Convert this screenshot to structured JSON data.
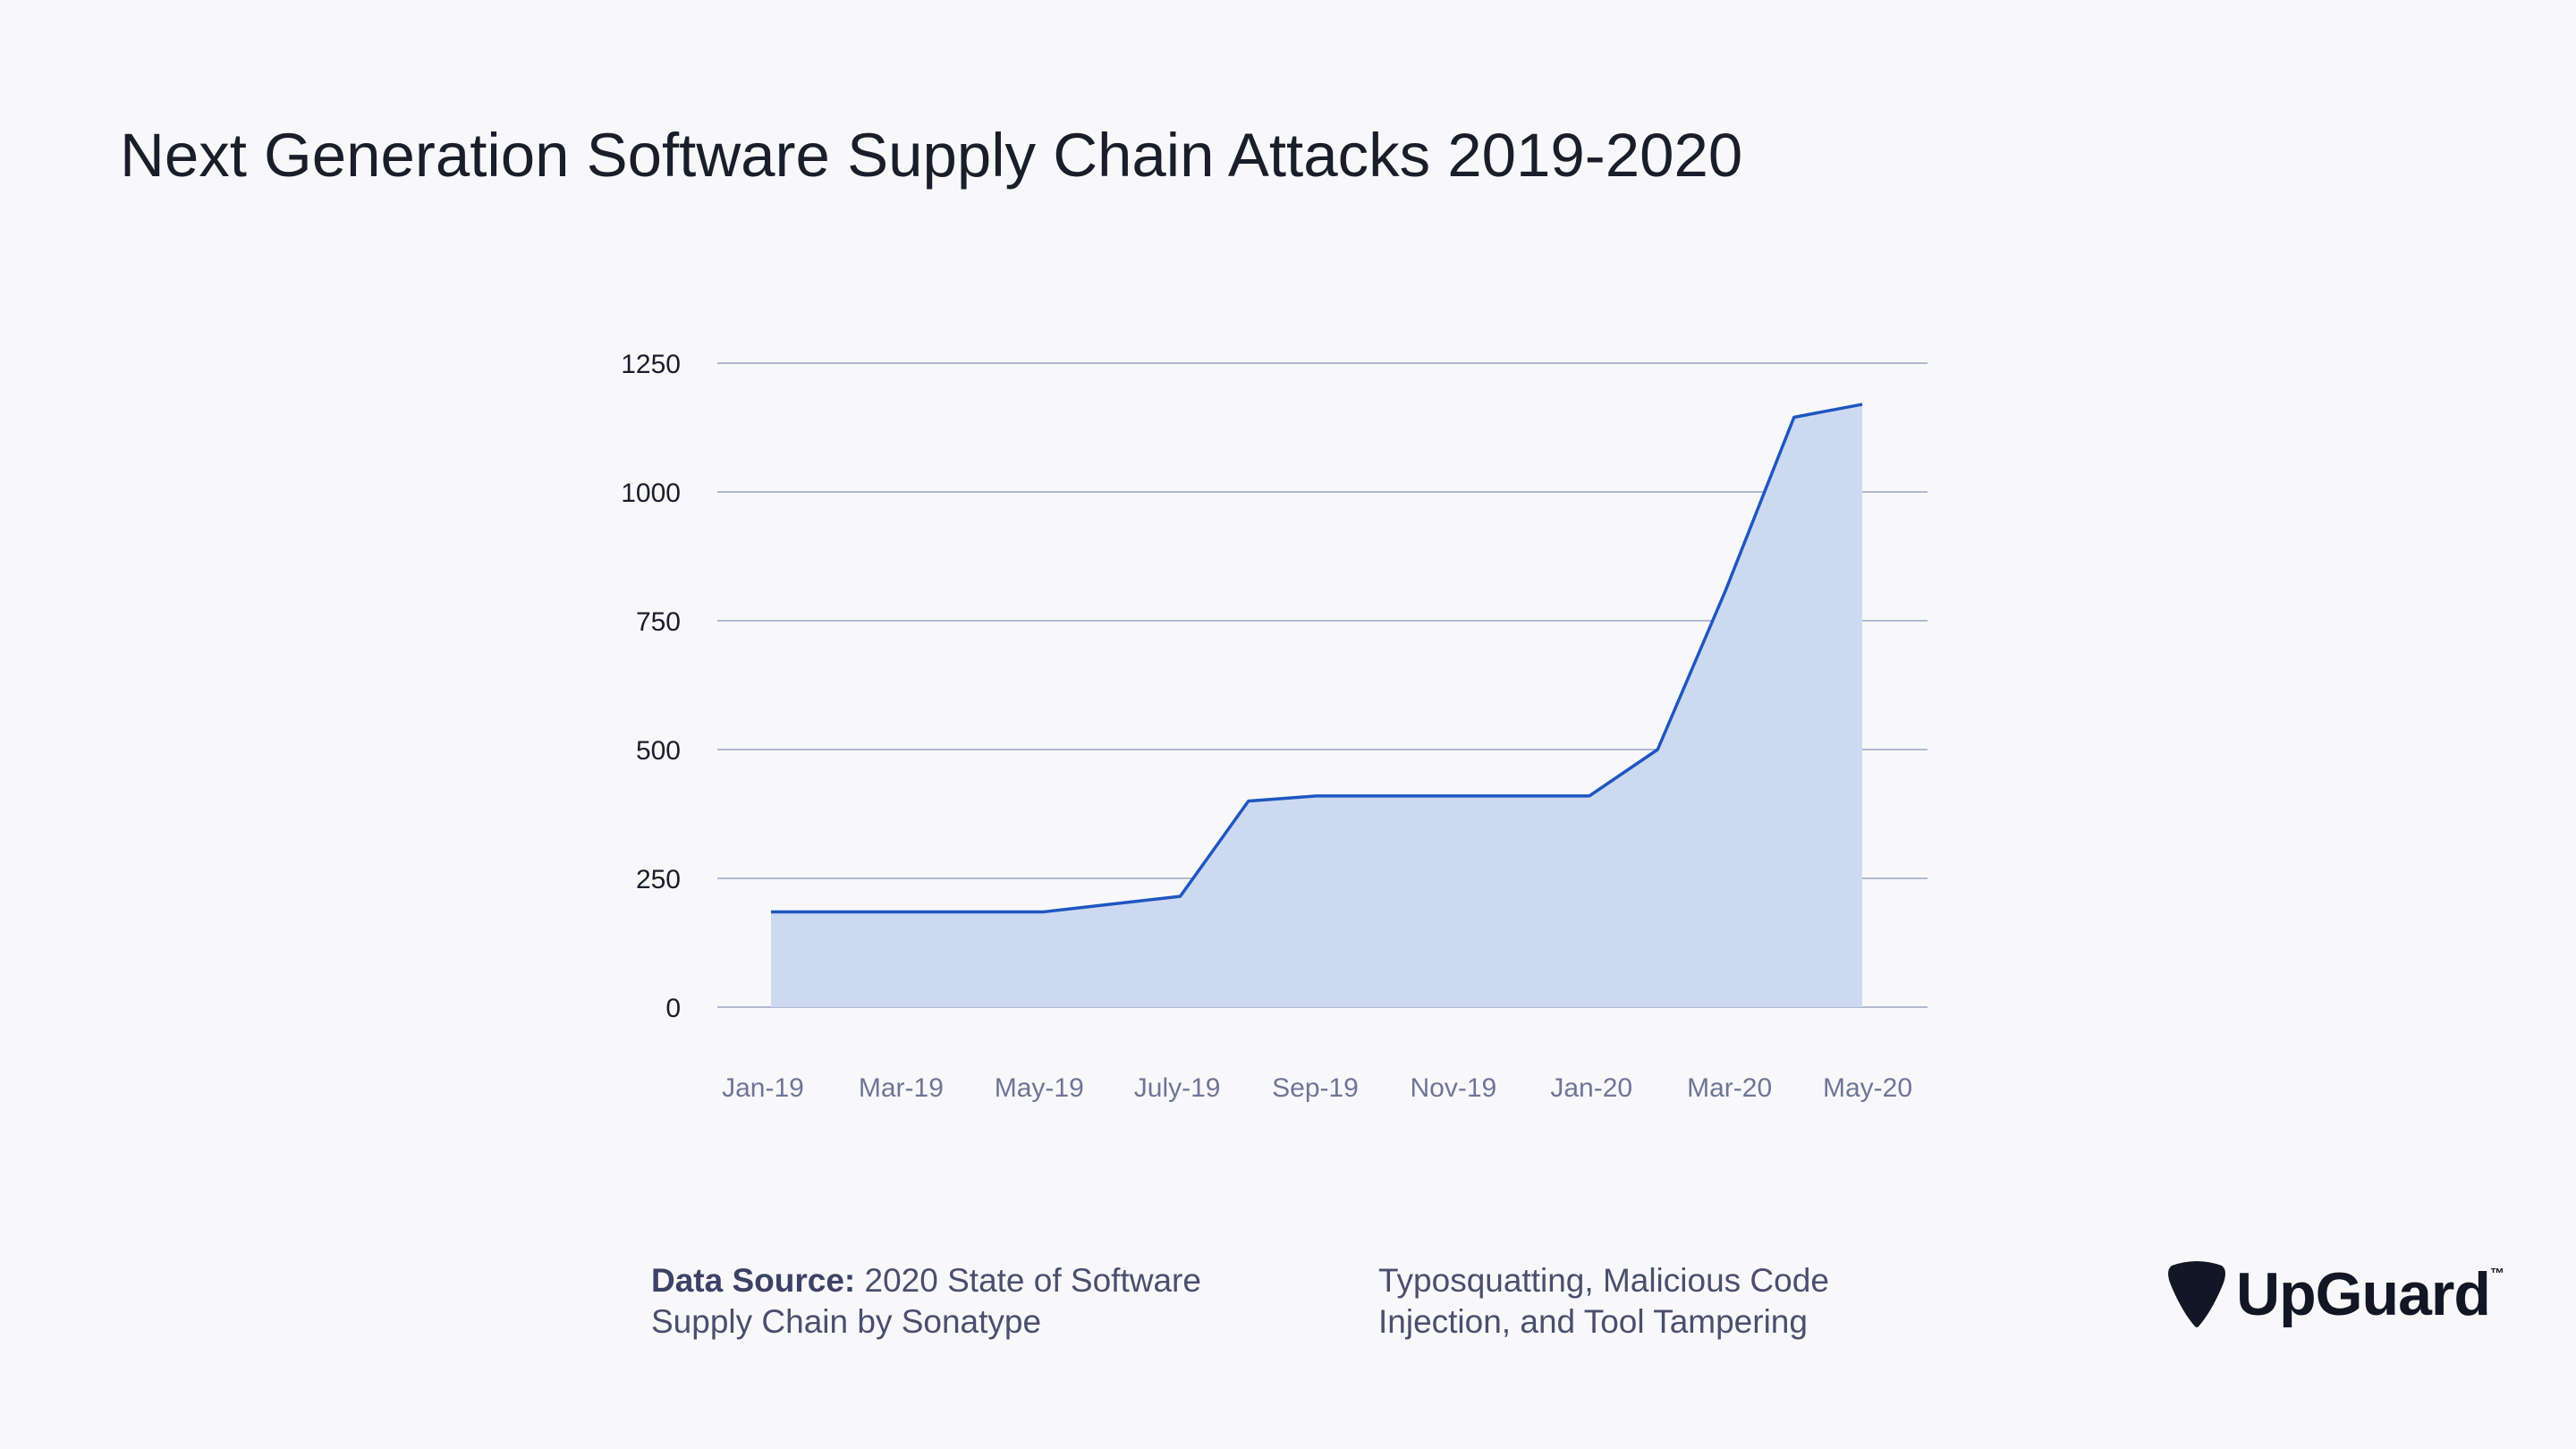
{
  "title": "Next Generation Software Supply Chain Attacks 2019-2020",
  "footer": {
    "source_label": "Data Source:",
    "source_text": "2020 State of Software Supply Chain by Sonatype",
    "categories_text": "Typosquatting, Malicious Code Injection, and Tool Tampering"
  },
  "logo": {
    "text": "UpGuard",
    "tm": "™",
    "icon": "guitar-pick-icon"
  },
  "colors": {
    "line": "#1f56c0",
    "fill": "#cdd9f1",
    "grid": "#b3b8cf",
    "ytick": "#1b1d2b",
    "xtick": "#6f7596"
  },
  "chart_data": {
    "type": "area",
    "title": "Next Generation Software Supply Chain Attacks 2019-2020",
    "xlabel": "",
    "ylabel": "",
    "ylim": [
      0,
      1250
    ],
    "yticks": [
      0,
      250,
      500,
      750,
      1000,
      1250
    ],
    "xtick_labels": [
      "Jan-19",
      "Mar-19",
      "May-19",
      "July-19",
      "Sep-19",
      "Nov-19",
      "Jan-20",
      "Mar-20",
      "May-20"
    ],
    "x": [
      "Jan-19",
      "Feb-19",
      "Mar-19",
      "Apr-19",
      "May-19",
      "Jun-19",
      "Jul-19",
      "Aug-19",
      "Sep-19",
      "Oct-19",
      "Nov-19",
      "Dec-19",
      "Jan-20",
      "Feb-20",
      "Mar-20",
      "Apr-20",
      "May-20"
    ],
    "values": [
      185,
      185,
      185,
      185,
      185,
      200,
      215,
      400,
      410,
      410,
      410,
      410,
      410,
      500,
      810,
      1145,
      1170
    ],
    "grid": true,
    "legend": "none"
  }
}
